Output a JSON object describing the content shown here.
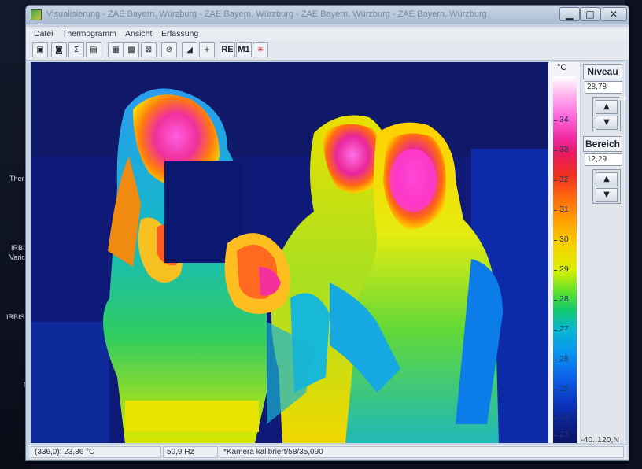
{
  "window": {
    "title": "Visualisierung - ZAE Bayern, Würzburg - ZAE Bayern, Würzburg - ZAE Bayern, Würzburg - ZAE Bayern, Würzburg",
    "min_glyph": "▁",
    "max_glyph": "□",
    "close_glyph": "✕"
  },
  "desktop": {
    "labels": [
      "Ther",
      "IRBI",
      "Varic",
      "IRBIS",
      "N"
    ]
  },
  "menu": {
    "items": [
      "Datei",
      "Thermogramm",
      "Ansicht",
      "Erfassung"
    ]
  },
  "toolbar": {
    "buttons": [
      {
        "icon": "image-icon",
        "glyph": "▣"
      },
      {
        "icon": "camera-icon",
        "glyph": "◙"
      },
      {
        "icon": "sum-icon",
        "glyph": "Σ"
      },
      {
        "icon": "display-icon",
        "glyph": "▤"
      },
      {
        "icon": "grid-icon",
        "glyph": "▦"
      },
      {
        "icon": "palette-icon",
        "glyph": "▩"
      },
      {
        "icon": "frame-icon",
        "glyph": "⊠"
      },
      {
        "icon": "clock-icon",
        "glyph": "⊘"
      },
      {
        "icon": "level-icon",
        "glyph": "◢"
      },
      {
        "icon": "crosshair-icon",
        "glyph": "+"
      }
    ],
    "re_label": "RE",
    "m1_label": "M1",
    "reset_glyph": "✳"
  },
  "scale": {
    "unit": "°C",
    "ticks": [
      "34",
      "33",
      "32",
      "31",
      "30",
      "29",
      "28",
      "27",
      "26",
      "25",
      "24",
      "23"
    ],
    "tag": "-40..120,N"
  },
  "controls": {
    "niveau_label": "Niveau",
    "niveau_value": "28,78",
    "bereich_label": "Bereich",
    "bereich_value": "12,29",
    "up_glyph": "▲",
    "down_glyph": "▼"
  },
  "status": {
    "cursor": "(336,0): 23,36 °C",
    "framerate": "50,9 Hz",
    "calibration": "*Kamera kalibriert/58/35,090"
  },
  "colors": {
    "background_cold": "#101a72",
    "accent_hot": "#ff66dc"
  }
}
